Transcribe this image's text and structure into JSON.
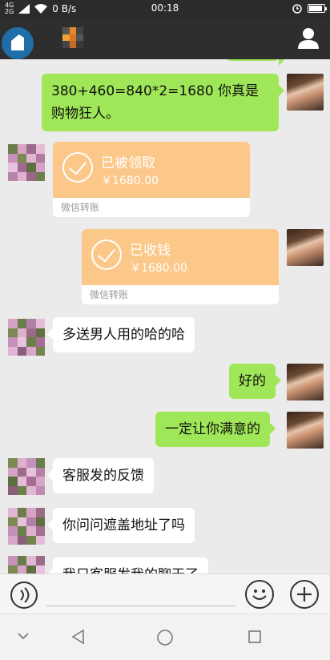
{
  "status_bar": {
    "signal_top": "4G",
    "signal_bottom": "2G",
    "net_speed": "0 B/s",
    "time": "00:18",
    "icons": [
      "signal-icon",
      "wifi-icon",
      "alarm-icon",
      "battery-icon"
    ],
    "battery_level": 0.9
  },
  "header": {
    "icons": [
      "back-avatar-icon",
      "profile-icon"
    ]
  },
  "messages": {
    "m1": {
      "side": "right",
      "text": "380+460=840*2=1680 你真是购物狂人。"
    },
    "m2": {
      "side": "left",
      "type": "transfer",
      "status": "已被领取",
      "amount": "￥1680.00",
      "footer": "微信转账"
    },
    "m3": {
      "side": "right",
      "type": "transfer",
      "status": "已收钱",
      "amount": "￥1680.00",
      "footer": "微信转账"
    },
    "m4": {
      "side": "left",
      "text": "多送男人用的哈的哈"
    },
    "m5": {
      "side": "right",
      "text": "好的"
    },
    "m6": {
      "side": "right",
      "text": "一定让你满意的"
    },
    "m7": {
      "side": "left",
      "text": "客服发的反馈"
    },
    "m8": {
      "side": "left",
      "text": "你问问遮盖地址了吗"
    },
    "m9": {
      "side": "left",
      "text": "我只客服发我的聊天了"
    }
  },
  "input_bar": {
    "value": "",
    "icons": [
      "voice-icon",
      "emoji-icon",
      "plus-icon"
    ]
  },
  "nav_bar": {
    "icons": [
      "nav-menu-icon",
      "back-icon",
      "home-icon",
      "recents-icon"
    ]
  },
  "colors": {
    "header_bg": "#2e2e2e",
    "chat_bg": "#ebebeb",
    "sent_bubble": "#9fe658",
    "received_bubble": "#ffffff",
    "transfer_bubble": "#fbc889"
  }
}
